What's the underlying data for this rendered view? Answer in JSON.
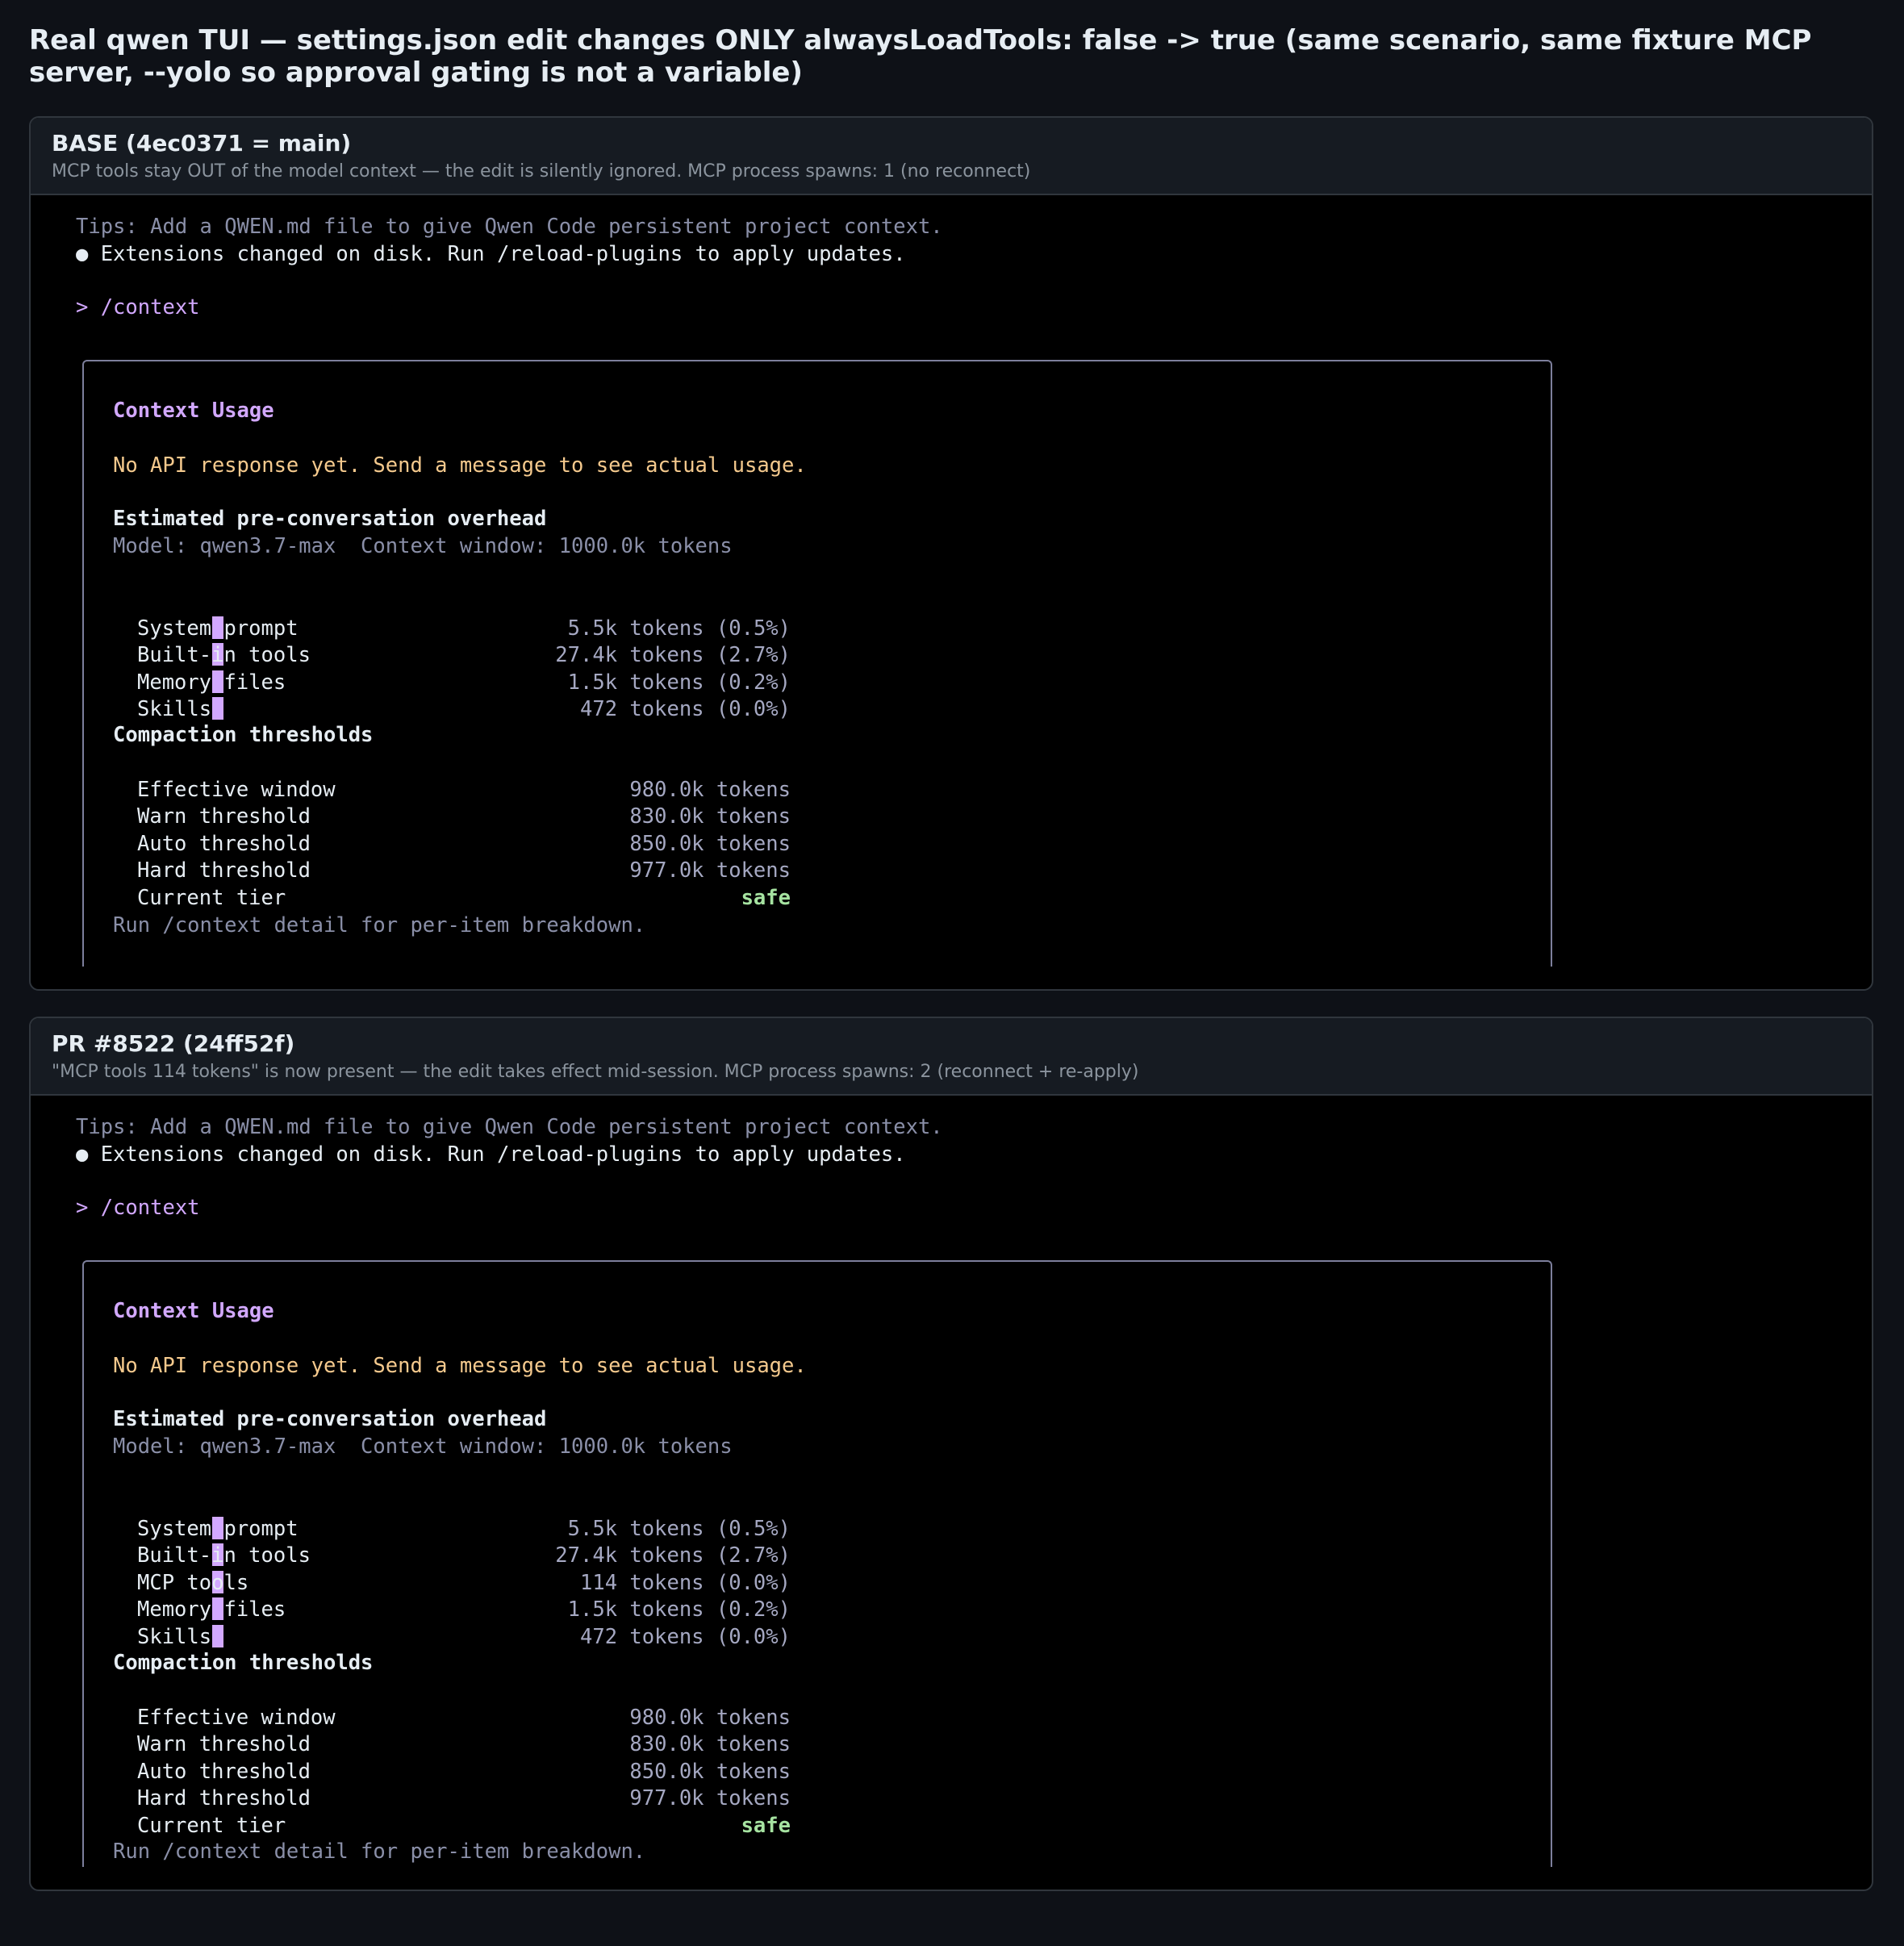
{
  "page": {
    "title": "Real qwen TUI — settings.json edit changes ONLY alwaysLoadTools: false -> true (same scenario, same fixture MCP server, --yolo so approval gating is not a variable)"
  },
  "panels": [
    {
      "title": "BASE (4ec0371 = main)",
      "subtitle": "MCP tools stay OUT of the model context — the edit is silently ignored. MCP process spawns: 1 (no reconnect)",
      "tips": "Tips: Add a QWEN.md file to give Qwen Code persistent project context.",
      "notice": "● Extensions changed on disk. Run /reload-plugins to apply updates.",
      "prompt": "> /context",
      "context": {
        "title": "Context Usage",
        "warning": "No API response yet. Send a message to see actual usage.",
        "overhead_heading": "Estimated pre-conversation overhead",
        "model_line": "Model: qwen3.7-max  Context window: 1000.0k tokens",
        "rows": [
          {
            "label": "System prompt",
            "value": "5.5k tokens (0.5%)"
          },
          {
            "label": "Built-in tools",
            "value": "27.4k tokens (2.7%)"
          },
          {
            "label": "Memory files",
            "value": "1.5k tokens (0.2%)"
          },
          {
            "label": "Skills",
            "value": "472 tokens (0.0%)"
          }
        ],
        "thresholds_heading": "Compaction thresholds",
        "thresholds": [
          {
            "label": "Effective window",
            "value": "980.0k tokens"
          },
          {
            "label": "Warn threshold",
            "value": "830.0k tokens"
          },
          {
            "label": "Auto threshold",
            "value": "850.0k tokens"
          },
          {
            "label": "Hard threshold",
            "value": "977.0k tokens"
          }
        ],
        "tier_label": "Current tier",
        "tier_value": "safe",
        "footer": "Run /context detail for per-item breakdown."
      }
    },
    {
      "title": "PR #8522 (24ff52f)",
      "subtitle": "\"MCP tools 114 tokens\" is now present — the edit takes effect mid-session. MCP process spawns: 2 (reconnect + re-apply)",
      "tips": "Tips: Add a QWEN.md file to give Qwen Code persistent project context.",
      "notice": "● Extensions changed on disk. Run /reload-plugins to apply updates.",
      "prompt": "> /context",
      "context": {
        "title": "Context Usage",
        "warning": "No API response yet. Send a message to see actual usage.",
        "overhead_heading": "Estimated pre-conversation overhead",
        "model_line": "Model: qwen3.7-max  Context window: 1000.0k tokens",
        "rows": [
          {
            "label": "System prompt",
            "value": "5.5k tokens (0.5%)"
          },
          {
            "label": "Built-in tools",
            "value": "27.4k tokens (2.7%)"
          },
          {
            "label": "MCP tools",
            "value": "114 tokens (0.0%)"
          },
          {
            "label": "Memory files",
            "value": "1.5k tokens (0.2%)"
          },
          {
            "label": "Skills",
            "value": "472 tokens (0.0%)"
          }
        ],
        "thresholds_heading": "Compaction thresholds",
        "thresholds": [
          {
            "label": "Effective window",
            "value": "980.0k tokens"
          },
          {
            "label": "Warn threshold",
            "value": "830.0k tokens"
          },
          {
            "label": "Auto threshold",
            "value": "850.0k tokens"
          },
          {
            "label": "Hard threshold",
            "value": "977.0k tokens"
          }
        ],
        "tier_label": "Current tier",
        "tier_value": "safe",
        "footer": "Run /context detail for per-item breakdown."
      }
    }
  ]
}
